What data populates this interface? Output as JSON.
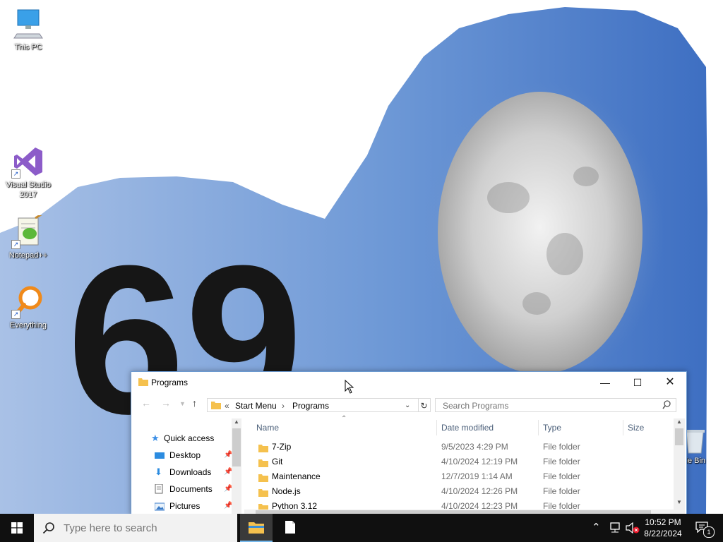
{
  "desktop": {
    "icons": [
      {
        "label": "This PC",
        "icon": "this-pc-icon"
      },
      {
        "label": "Visual Studio 2017",
        "icon": "visual-studio-icon"
      },
      {
        "label": "Notepad++",
        "icon": "notepad-plus-plus-icon"
      },
      {
        "label": "Everything",
        "icon": "everything-search-icon"
      },
      {
        "label": "cle Bin",
        "icon": "recycle-bin-icon"
      }
    ]
  },
  "explorer": {
    "title": "Programs",
    "breadcrumb": {
      "overflow": "«",
      "items": [
        "Start Menu",
        "Programs"
      ]
    },
    "search_placeholder": "Search Programs",
    "nav": {
      "quick_access": "Quick access",
      "items": [
        {
          "label": "Desktop",
          "icon": "desktop-icon",
          "pinned": true
        },
        {
          "label": "Downloads",
          "icon": "downloads-icon",
          "pinned": true
        },
        {
          "label": "Documents",
          "icon": "documents-icon",
          "pinned": true
        },
        {
          "label": "Pictures",
          "icon": "pictures-icon",
          "pinned": true
        }
      ]
    },
    "columns": {
      "name": "Name",
      "date": "Date modified",
      "type": "Type",
      "size": "Size"
    },
    "files": [
      {
        "name": "7-Zip",
        "date": "9/5/2023 4:29 PM",
        "type": "File folder"
      },
      {
        "name": "Git",
        "date": "4/10/2024 12:19 PM",
        "type": "File folder"
      },
      {
        "name": "Maintenance",
        "date": "12/7/2019 1:14 AM",
        "type": "File folder"
      },
      {
        "name": "Node.js",
        "date": "4/10/2024 12:26 PM",
        "type": "File folder"
      },
      {
        "name": "Python 3.12",
        "date": "4/10/2024 12:23 PM",
        "type": "File folder"
      }
    ]
  },
  "taskbar": {
    "search_placeholder": "Type here to search",
    "time": "10:52 PM",
    "date": "8/22/2024",
    "notification_count": "1"
  },
  "colors": {
    "accent": "#0078d7",
    "folder": "#f5c14e",
    "wallpaper_blue": "#5b8bd0"
  }
}
